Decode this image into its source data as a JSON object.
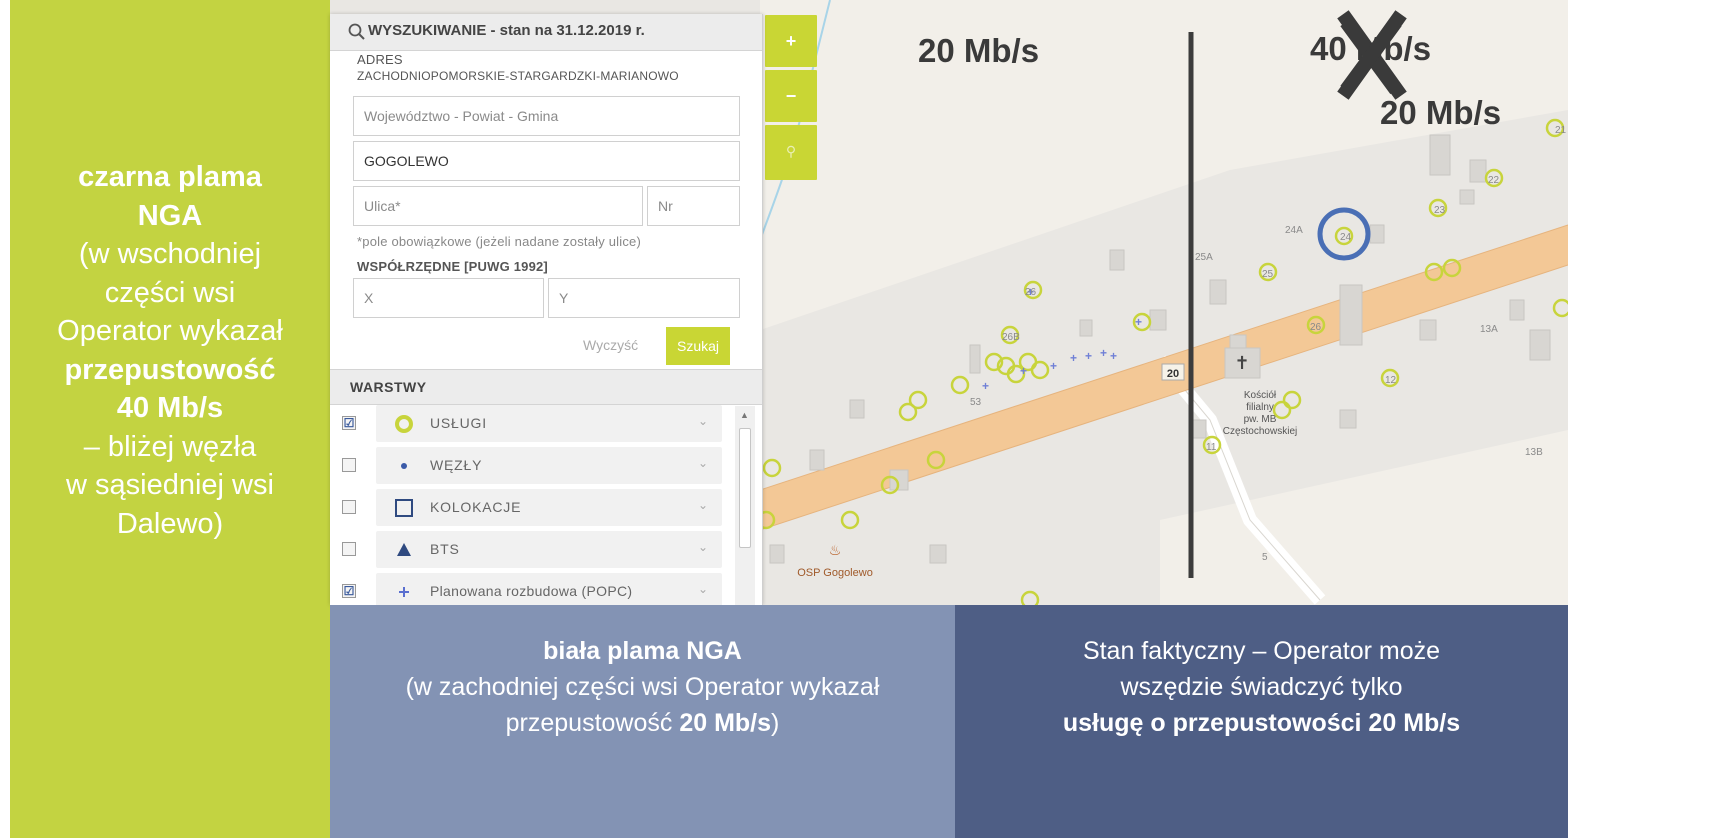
{
  "left_callout": {
    "line1": "czarna plama",
    "line2": "NGA",
    "line3": "(w wschodniej",
    "line4": "części wsi",
    "line5": "Operator wykazał",
    "line6": "przepustowość",
    "line7": "40 Mb/s",
    "line8": "– bliżej węzła",
    "line9": "w sąsiedniej wsi",
    "line10": "Dalewo)"
  },
  "search_panel": {
    "title": "WYSZUKIWANIE - stan na 31.12.2019 r.",
    "address_label": "ADRES",
    "address_path": "ZACHODNIOPOMORSKIE-STARGARDZKI-MARIANOWO",
    "region_placeholder": "Województwo - Powiat - Gmina",
    "locality_value": "GOGOLEWO",
    "street_placeholder": "Ulica*",
    "number_placeholder": "Nr",
    "required_note": "*pole obowiązkowe (jeżeli nadane zostały ulice)",
    "coords_label": "WSPÓŁRZĘDNE [PUWG 1992]",
    "x_placeholder": "X",
    "y_placeholder": "Y",
    "clear_label": "Wyczyść",
    "search_label": "Szukaj"
  },
  "layers": {
    "header": "WARSTWY",
    "items": [
      {
        "label": "USŁUGI",
        "checked": "☑",
        "icon": "yellow-ring-icon"
      },
      {
        "label": "WĘZŁY",
        "checked": "",
        "icon": "blue-dot-icon"
      },
      {
        "label": "KOLOKACJE",
        "checked": "",
        "icon": "square-outline-icon"
      },
      {
        "label": "BTS",
        "checked": "",
        "icon": "triangle-icon"
      },
      {
        "label": "Planowana rozbudowa (POPC)",
        "checked": "☑",
        "icon": "plus-icon"
      }
    ]
  },
  "zoom": {
    "zoom_in": "+",
    "zoom_out": "−",
    "zoom_search": "⚲"
  },
  "map": {
    "speed_left": "20 Mb/s",
    "speed_right_crossed": "40 Mb/s",
    "speed_right": "20 Mb/s",
    "road_number": "20",
    "church_label_1": "Kościół",
    "church_label_2": "filialny",
    "church_label_3": "pw. MB",
    "church_label_4": "Częstochowskiej",
    "fire_station": "OSP Gogolewo",
    "house_numbers": [
      "22",
      "23",
      "24A",
      "24",
      "25A",
      "25",
      "26",
      "26B",
      "26",
      "53",
      "13A",
      "13B",
      "11",
      "12",
      "5",
      "21"
    ]
  },
  "box_mid": {
    "bold": "biała plama NGA",
    "line2": "(w zachodniej części wsi Operator wykazał",
    "line3_pre": "przepustowość ",
    "line3_bold": "20 Mb/s",
    "line3_post": ")"
  },
  "box_right": {
    "line1": "Stan faktyczny – Operator może",
    "line2": "wszędzie świadczyć tylko",
    "line3_bold": "usługę o przepustowości 20 Mb/s"
  },
  "colors": {
    "green_accent": "#c3d341",
    "panel_green": "#c9d634",
    "box_mid": "#8393b4",
    "box_right": "#4e5e85",
    "road": "#f3c896",
    "map_bg": "#e9e7e3",
    "highlight_circle": "#4a6fb5"
  }
}
